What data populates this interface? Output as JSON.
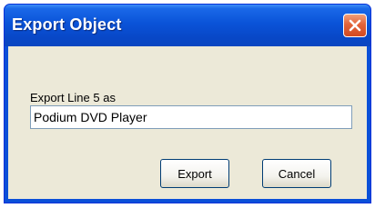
{
  "window": {
    "title": "Export Object",
    "close_icon": "close-icon"
  },
  "form": {
    "label": "Export Line 5 as",
    "value": "Podium DVD Player"
  },
  "buttons": {
    "export_label": "Export",
    "cancel_label": "Cancel"
  },
  "colors": {
    "titlebar": "#0a53d8",
    "close_button": "#e3643a",
    "client_background": "#ece9d8"
  }
}
